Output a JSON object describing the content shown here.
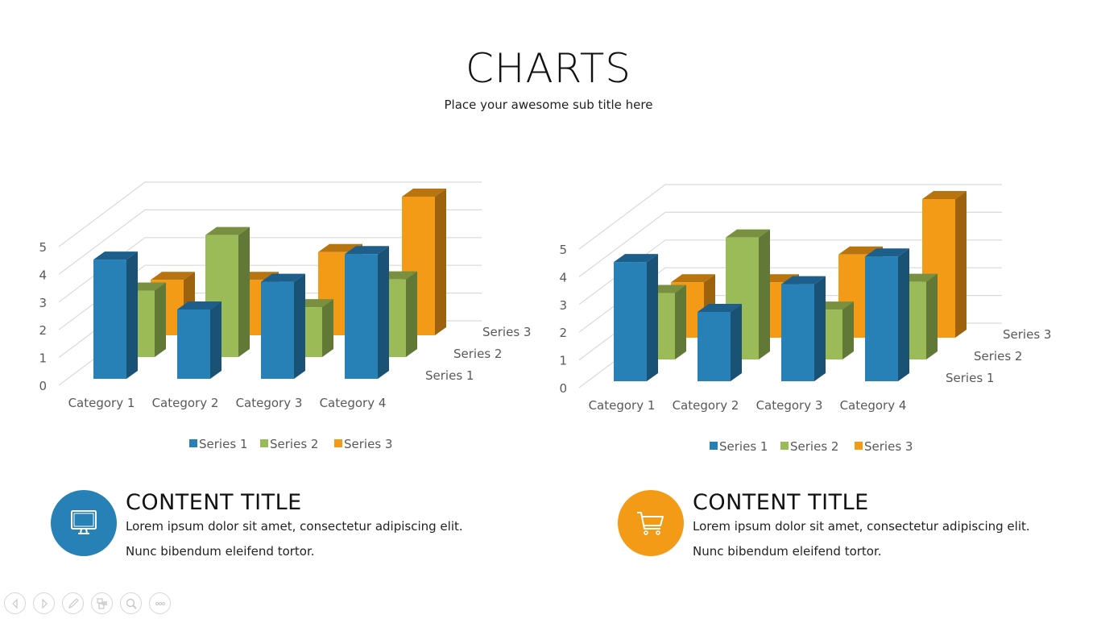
{
  "header": {
    "title": "CHARTS",
    "subtitle": "Place your awesome sub title here"
  },
  "colors": {
    "series1": "#2780B6",
    "series2": "#9BBB59",
    "series3": "#F39A16",
    "blue_accent": "#2780B6",
    "orange_accent": "#F39A16"
  },
  "chart_data": [
    {
      "type": "bar",
      "subtype": "3d-column",
      "title": "",
      "categories": [
        "Category 1",
        "Category 2",
        "Category 3",
        "Category 4"
      ],
      "series": [
        {
          "name": "Series 1",
          "values": [
            4.3,
            2.5,
            3.5,
            4.5
          ]
        },
        {
          "name": "Series 2",
          "values": [
            2.4,
            4.4,
            1.8,
            2.8
          ]
        },
        {
          "name": "Series 3",
          "values": [
            2,
            2,
            3,
            5
          ]
        }
      ],
      "yticks": [
        "0",
        "1",
        "2",
        "3",
        "4",
        "5"
      ],
      "ylim": [
        0,
        5
      ],
      "depth_labels": [
        "Series 1",
        "Series 2",
        "Series 3"
      ],
      "legend": [
        "Series 1",
        "Series 2",
        "Series 3"
      ],
      "legend_position": "bottom",
      "grid": true
    },
    {
      "type": "bar",
      "subtype": "3d-column",
      "title": "",
      "categories": [
        "Category 1",
        "Category 2",
        "Category 3",
        "Category 4"
      ],
      "series": [
        {
          "name": "Series 1",
          "values": [
            4.3,
            2.5,
            3.5,
            4.5
          ]
        },
        {
          "name": "Series 2",
          "values": [
            2.4,
            4.4,
            1.8,
            2.8
          ]
        },
        {
          "name": "Series 3",
          "values": [
            2,
            2,
            3,
            5
          ]
        }
      ],
      "yticks": [
        "0",
        "1",
        "2",
        "3",
        "4",
        "5"
      ],
      "ylim": [
        0,
        5
      ],
      "depth_labels": [
        "Series 1",
        "Series 2",
        "Series 3"
      ],
      "legend": [
        "Series 1",
        "Series 2",
        "Series 3"
      ],
      "legend_position": "bottom",
      "grid": true
    }
  ],
  "content_blocks": [
    {
      "icon": "monitor-icon",
      "title": "CONTENT TITLE",
      "line1": "Lorem ipsum dolor sit amet, consectetur adipiscing elit.",
      "line2": "Nunc bibendum eleifend tortor."
    },
    {
      "icon": "shopping-cart-icon",
      "title": "CONTENT TITLE",
      "line1": "Lorem ipsum dolor sit amet, consectetur adipiscing elit.",
      "line2": "Nunc bibendum eleifend tortor."
    }
  ],
  "nav": [
    "previous-slide",
    "next-slide",
    "pen",
    "slides-overview",
    "zoom",
    "more-options"
  ]
}
